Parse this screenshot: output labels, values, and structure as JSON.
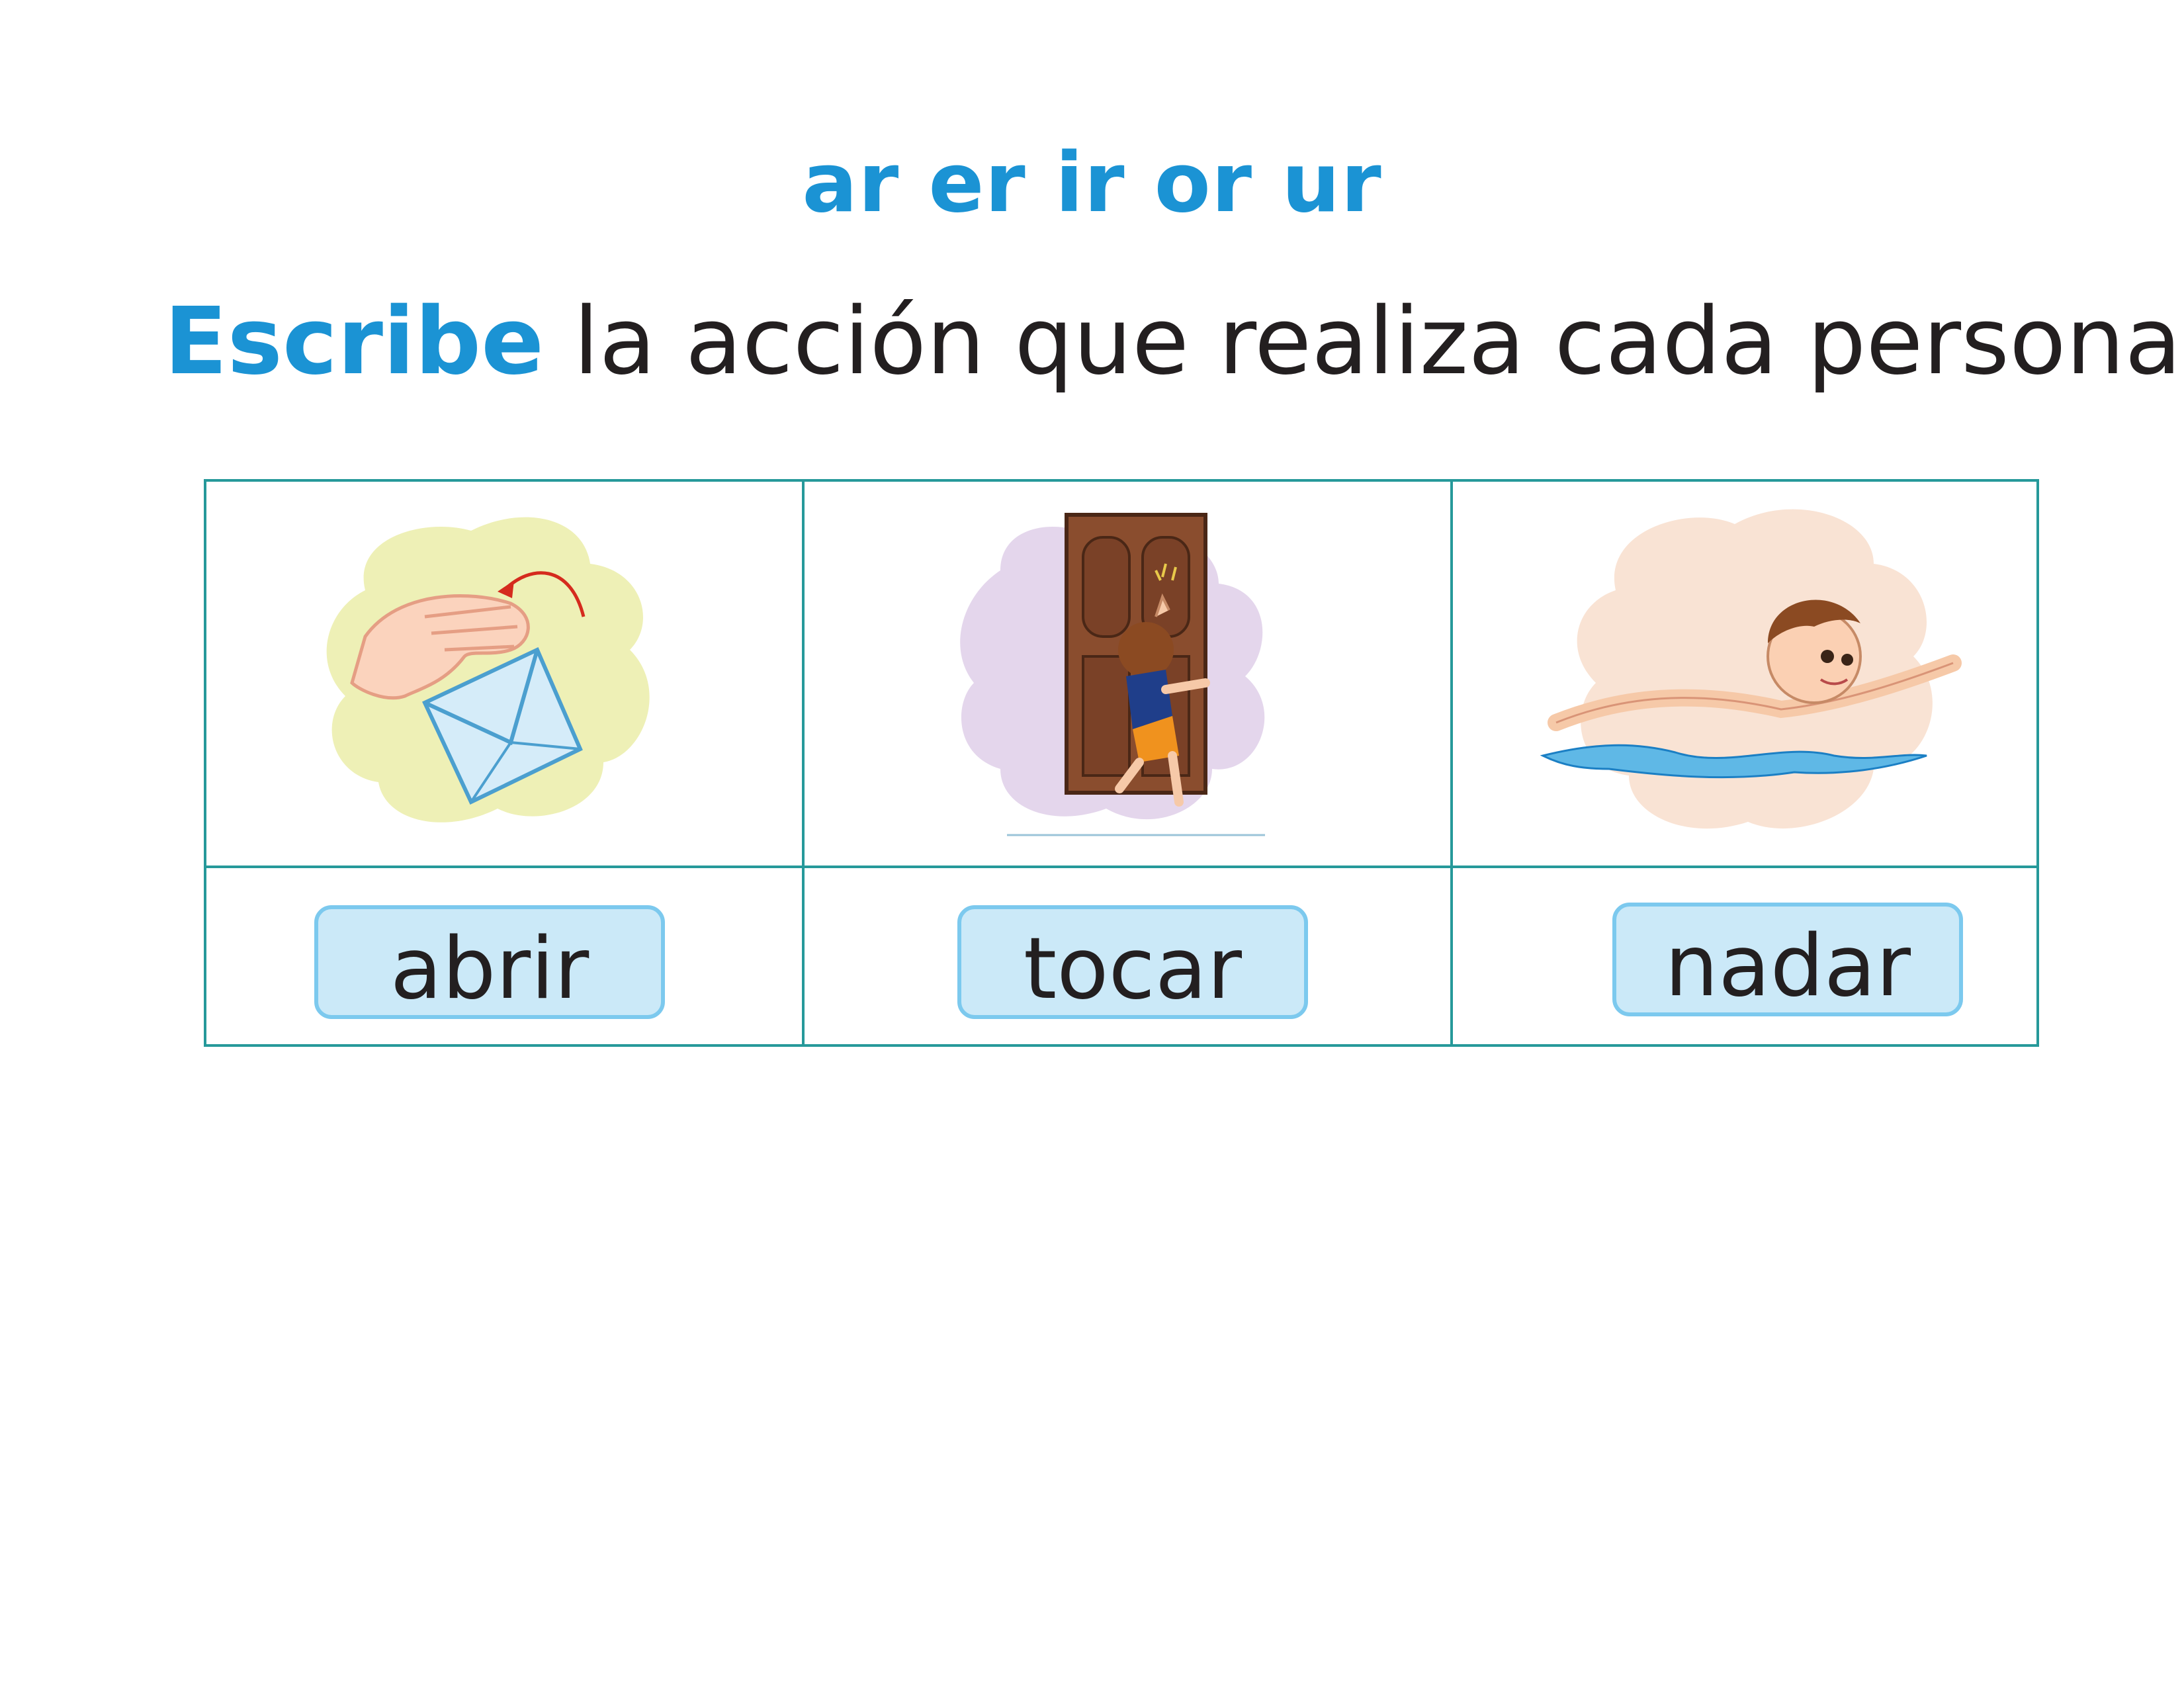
{
  "header": {
    "title": "ar er ir or ur",
    "instruction_verb": "Escribe",
    "instruction_rest": " la acción que realiza cada persona."
  },
  "colors": {
    "accent": "#1b93d4",
    "grid": "#26999a",
    "answer_fill": "#cbe9f8",
    "answer_border": "#7cc9ee"
  },
  "items": [
    {
      "picture": "hand-opening-envelope",
      "answer": "abrir"
    },
    {
      "picture": "boy-knocking-door",
      "answer": "tocar"
    },
    {
      "picture": "boy-swimming",
      "answer": "nadar"
    }
  ]
}
